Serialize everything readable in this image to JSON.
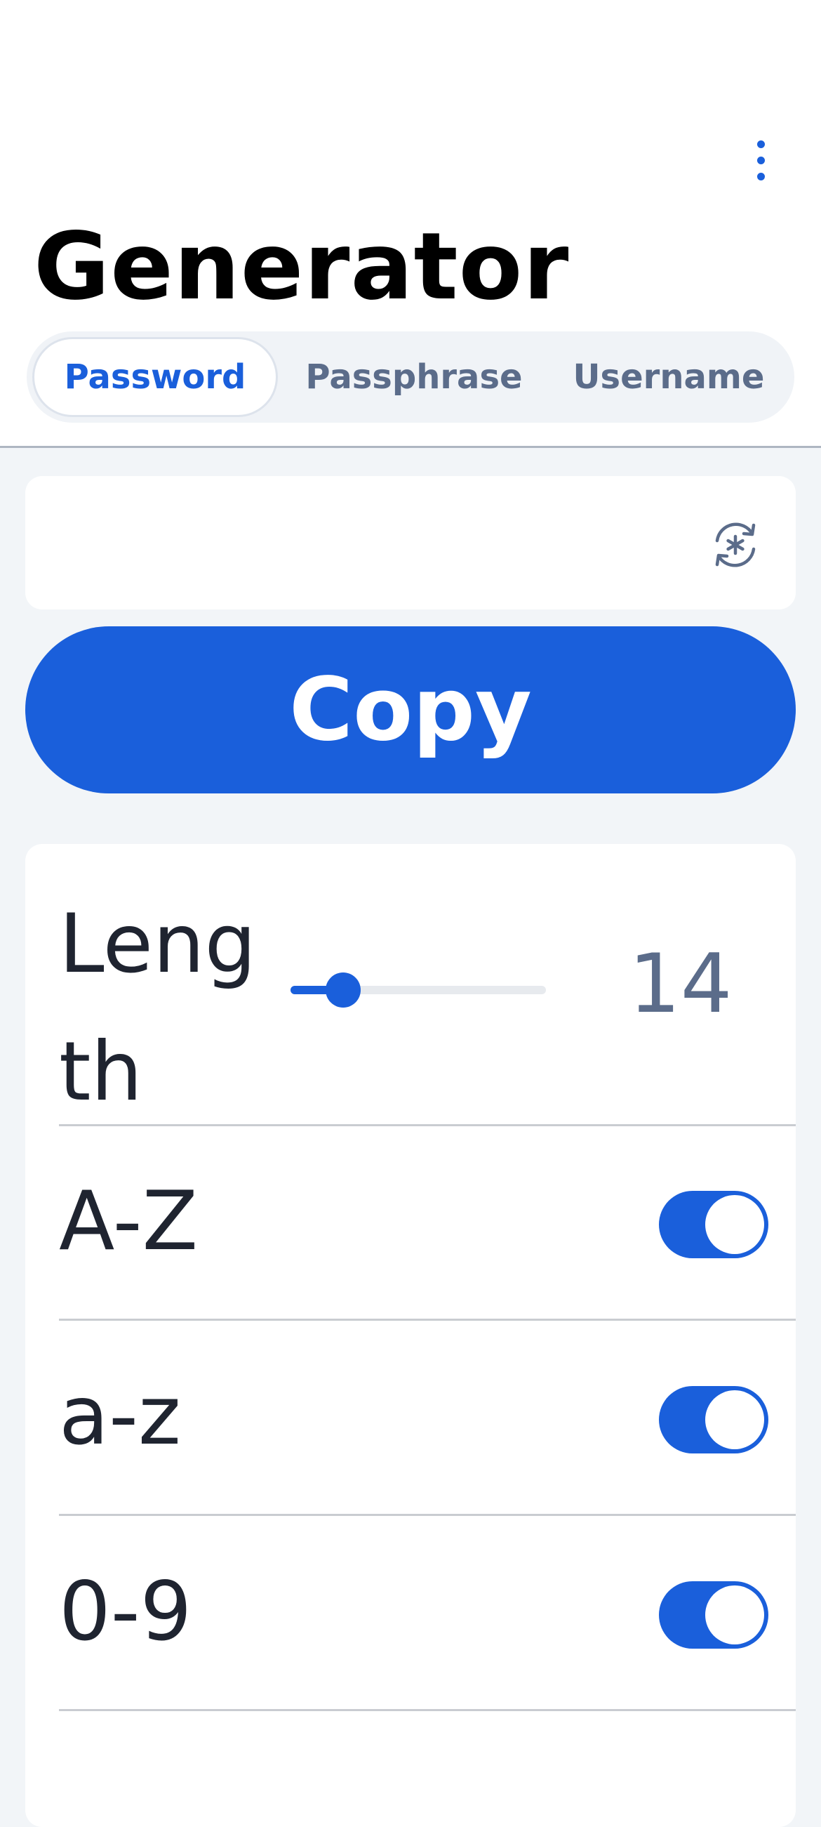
{
  "header": {
    "title": "Generator",
    "more_icon": "more-vertical-icon"
  },
  "tabs": [
    {
      "label": "Password",
      "selected": true
    },
    {
      "label": "Passphrase",
      "selected": false
    },
    {
      "label": "Username",
      "selected": false
    }
  ],
  "password": {
    "value": "",
    "regenerate_icon": "regenerate-icon"
  },
  "copy": {
    "label": "Copy"
  },
  "options": {
    "length": {
      "label": "Length",
      "value": "14",
      "min": 5,
      "max": 128,
      "current": 14
    },
    "uppercase": {
      "label": "A-Z",
      "enabled": true
    },
    "lowercase": {
      "label": "a-z",
      "enabled": true
    },
    "numbers": {
      "label": "0-9",
      "enabled": true
    }
  },
  "colors": {
    "accent": "#1a5fdb",
    "muted_text": "#5b6c8a",
    "background": "#f2f5f8"
  }
}
